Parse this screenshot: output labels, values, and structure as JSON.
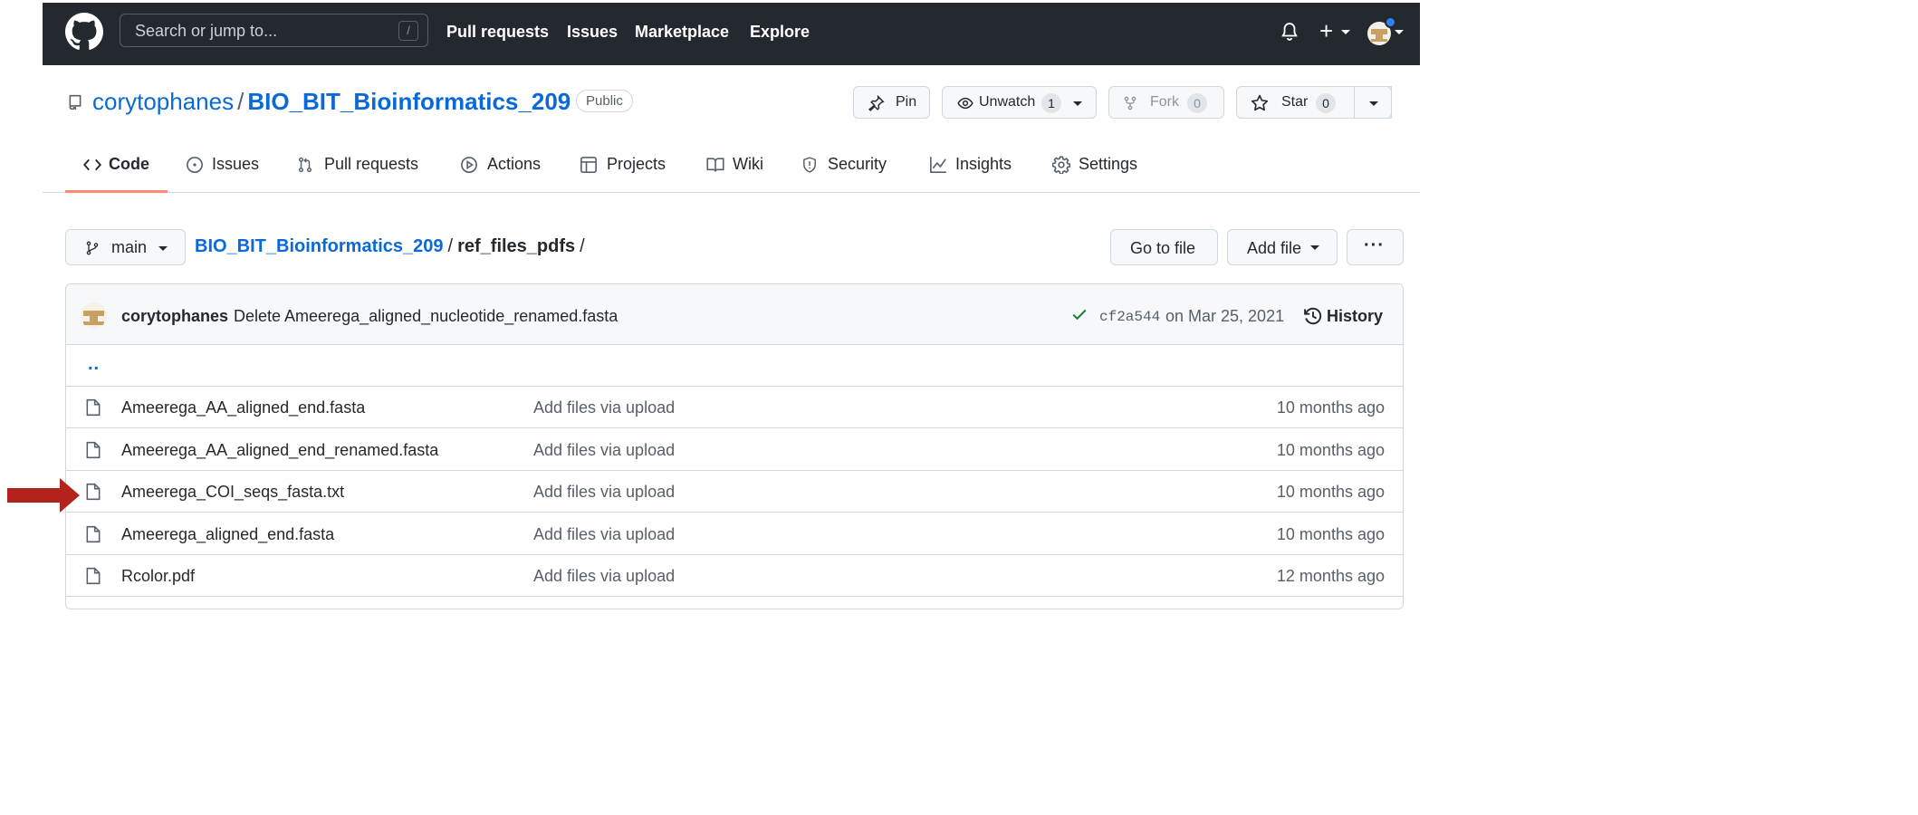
{
  "header": {
    "search_placeholder": "Search or jump to...",
    "search_shortcut": "/",
    "nav": [
      "Pull requests",
      "Issues",
      "Marketplace",
      "Explore"
    ]
  },
  "repo": {
    "owner": "corytophanes",
    "separator": "/",
    "name": "BIO_BIT_Bioinformatics_209",
    "visibility": "Public",
    "actions": {
      "pin": "Pin",
      "watch": "Unwatch",
      "watch_count": "1",
      "fork": "Fork",
      "fork_count": "0",
      "star": "Star",
      "star_count": "0"
    },
    "tabs": [
      "Code",
      "Issues",
      "Pull requests",
      "Actions",
      "Projects",
      "Wiki",
      "Security",
      "Insights",
      "Settings"
    ]
  },
  "path": {
    "branch": "main",
    "repo": "BIO_BIT_Bioinformatics_209",
    "sep": "/",
    "dir": "ref_files_pdfs",
    "trail": "/",
    "go_to_file": "Go to file",
    "add_file": "Add file",
    "more": "···"
  },
  "commit": {
    "author": "corytophanes",
    "message": "Delete Ameerega_aligned_nucleotide_renamed.fasta",
    "sha": "cf2a544",
    "date": "on Mar 25, 2021",
    "history": "History"
  },
  "files": {
    "updir": "..",
    "rows": [
      {
        "name": "Ameerega_AA_aligned_end.fasta",
        "message": "Add files via upload",
        "age": "10 months ago"
      },
      {
        "name": "Ameerega_AA_aligned_end_renamed.fasta",
        "message": "Add files via upload",
        "age": "10 months ago"
      },
      {
        "name": "Ameerega_COI_seqs_fasta.txt",
        "message": "Add files via upload",
        "age": "10 months ago"
      },
      {
        "name": "Ameerega_aligned_end.fasta",
        "message": "Add files via upload",
        "age": "10 months ago"
      },
      {
        "name": "Rcolor.pdf",
        "message": "Add files via upload",
        "age": "12 months ago"
      }
    ]
  },
  "colors": {
    "header_bg": "#24292f",
    "link": "#0969da",
    "tab_underline": "#fd8c73",
    "success": "#1a7f37",
    "annotation_arrow": "#b3221b"
  },
  "icons": [
    "github-logo-icon",
    "bell-icon",
    "plus-icon",
    "repo-icon",
    "pin-icon",
    "eye-icon",
    "fork-icon",
    "star-icon",
    "code-icon",
    "issue-icon",
    "pull-request-icon",
    "play-icon",
    "table-icon",
    "book-icon",
    "shield-icon",
    "graph-icon",
    "gear-icon",
    "branch-icon",
    "check-icon",
    "history-icon",
    "file-icon",
    "arrow-icon"
  ]
}
